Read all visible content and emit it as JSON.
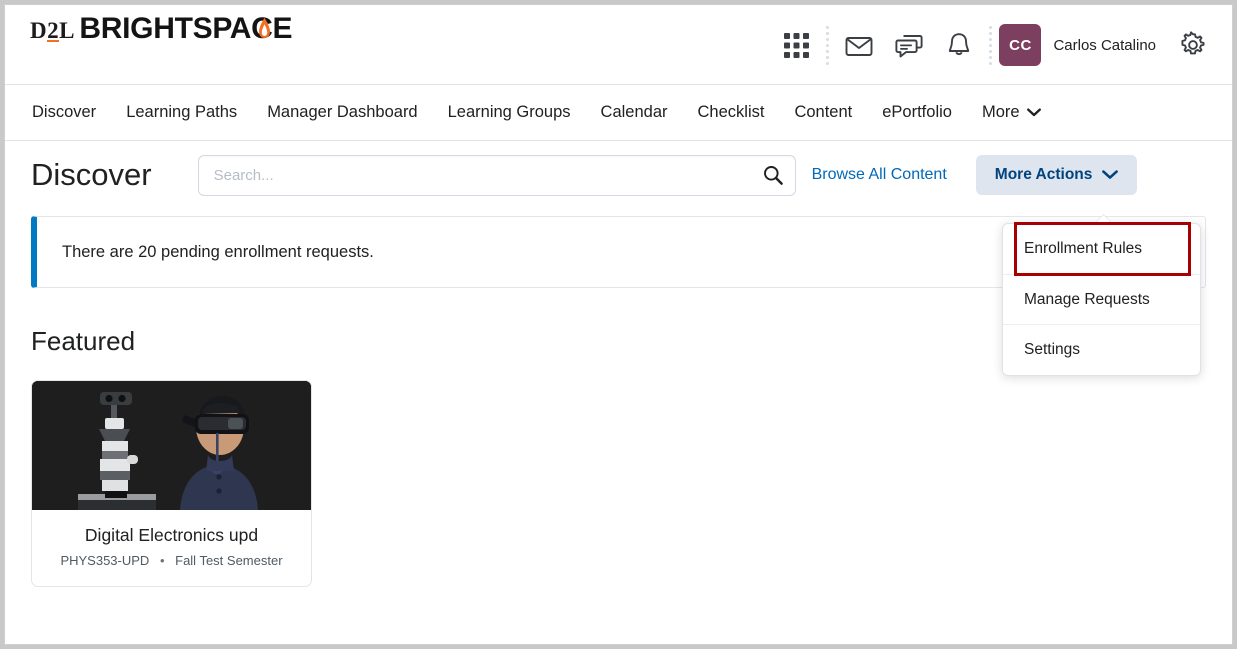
{
  "brand": {
    "logo_line1": "D2L",
    "logo_line1_parts": [
      "D",
      "2",
      "L"
    ],
    "logo_line2": "BRIGHTSPACE",
    "accent_orange": "#f37021"
  },
  "header": {
    "icons": [
      {
        "name": "waffle-grid-icon",
        "label": "Course selector"
      },
      {
        "name": "envelope-icon",
        "label": "Email"
      },
      {
        "name": "chat-icon",
        "label": "Subscription alerts"
      },
      {
        "name": "bell-icon",
        "label": "Update alerts"
      },
      {
        "name": "gear-icon",
        "label": "Settings"
      }
    ],
    "avatar_initials": "CC",
    "avatar_color": "#7d3f5f",
    "user_name": "Carlos Catalino"
  },
  "nav": {
    "items": [
      {
        "label": "Discover",
        "has_chevron": false
      },
      {
        "label": "Learning Paths",
        "has_chevron": false
      },
      {
        "label": "Manager Dashboard",
        "has_chevron": false
      },
      {
        "label": "Learning Groups",
        "has_chevron": false
      },
      {
        "label": "Calendar",
        "has_chevron": false
      },
      {
        "label": "Checklist",
        "has_chevron": false
      },
      {
        "label": "Content",
        "has_chevron": false
      },
      {
        "label": "ePortfolio",
        "has_chevron": false
      },
      {
        "label": "More",
        "has_chevron": true
      }
    ]
  },
  "toolbar": {
    "page_title": "Discover",
    "search_placeholder": "Search...",
    "search_value": "",
    "browse_all_label": "Browse All Content",
    "more_actions_label": "More Actions",
    "more_actions_bg": "#dfe5ee",
    "more_actions_color": "#00437e"
  },
  "dropdown": {
    "open": true,
    "highlight_color": "#a80000",
    "items": [
      {
        "label": "Enrollment Rules",
        "highlighted": true
      },
      {
        "label": "Manage Requests",
        "highlighted": false
      },
      {
        "label": "Settings",
        "highlighted": false
      }
    ]
  },
  "alert": {
    "text": "There are 20 pending enrollment requests.",
    "accent_color": "#007bc1"
  },
  "featured": {
    "heading": "Featured",
    "cards": [
      {
        "title": "Digital Electronics upd",
        "code": "PHYS353-UPD",
        "separator": "•",
        "term": "Fall Test Semester",
        "image_alt": "person-wearing-vr-headset-with-robot"
      }
    ]
  }
}
